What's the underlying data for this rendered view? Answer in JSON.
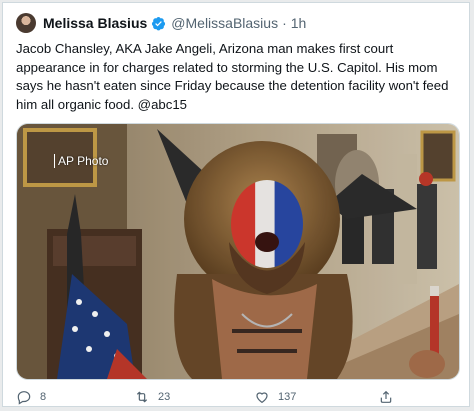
{
  "tweet": {
    "author_name": "Melissa Blasius",
    "handle": "@MelissaBlasius",
    "separator": "·",
    "time": "1h",
    "text": "Jacob Chansley, AKA Jake Angeli, Arizona man makes first court appearance in for charges related to storming the U.S. Capitol. His mom says he hasn't eaten since Friday because the detention facility won't feed him all organic food. @abc15",
    "photo_credit": "AP Photo"
  },
  "actions": {
    "reply_count": "8",
    "retweet_count": "23",
    "like_count": "137"
  },
  "icons": {
    "verified": "verified-badge-icon",
    "reply": "reply-icon",
    "retweet": "retweet-icon",
    "like": "heart-icon",
    "share": "share-icon"
  },
  "colors": {
    "verified": "#1d9bf0",
    "muted": "#536471",
    "text": "#0f1419"
  }
}
